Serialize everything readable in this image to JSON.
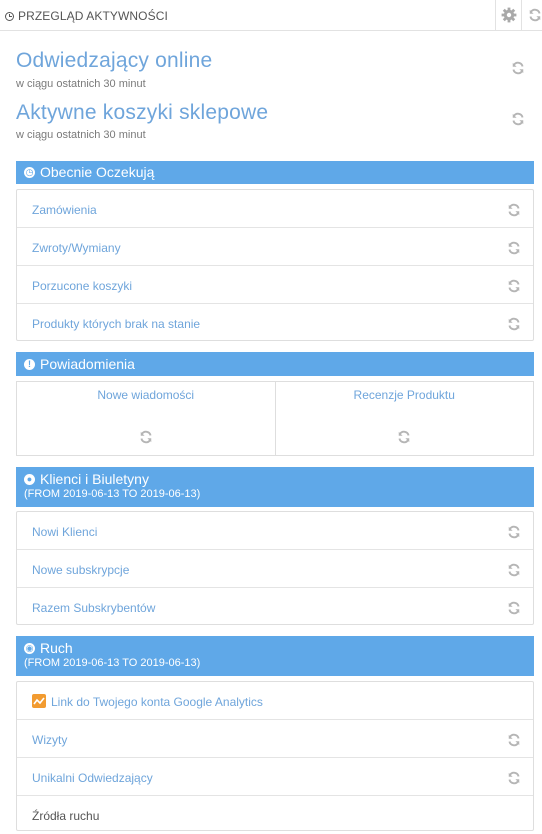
{
  "header": {
    "title": "PRZEGLĄD AKTYWNOŚCI"
  },
  "online": {
    "title": "Odwiedzający online",
    "subtitle": "w ciągu ostatnich 30 minut"
  },
  "carts": {
    "title": "Aktywne koszyki sklepowe",
    "subtitle": "w ciągu ostatnich 30 minut"
  },
  "pending": {
    "title": "Obecnie Oczekują",
    "items": [
      "Zamówienia",
      "Zwroty/Wymiany",
      "Porzucone koszyki",
      "Produkty których brak na stanie"
    ]
  },
  "notifications": {
    "title": "Powiadomienia",
    "items": [
      "Nowe wiadomości",
      "Recenzje Produktu"
    ]
  },
  "customers": {
    "title": "Klienci i Biuletyny",
    "dates": "(FROM 2019-06-13 TO 2019-06-13)",
    "items": [
      "Nowi Klienci",
      "Nowe subskrypcje",
      "Razem Subskrybentów"
    ]
  },
  "traffic": {
    "title": "Ruch",
    "dates": "(FROM 2019-06-13 TO 2019-06-13)",
    "ga_link": "Link do Twojego konta Google Analytics",
    "items": [
      "Wizyty",
      "Unikalni Odwiedzający",
      "Źródła ruchu"
    ]
  },
  "colors": {
    "accent": "#5fa8e8",
    "link": "#6fa5db",
    "ga": "#f29b30"
  },
  "icons": {
    "refresh": "refresh-icon",
    "settings": "gear-icon",
    "clock": "clock-icon"
  }
}
